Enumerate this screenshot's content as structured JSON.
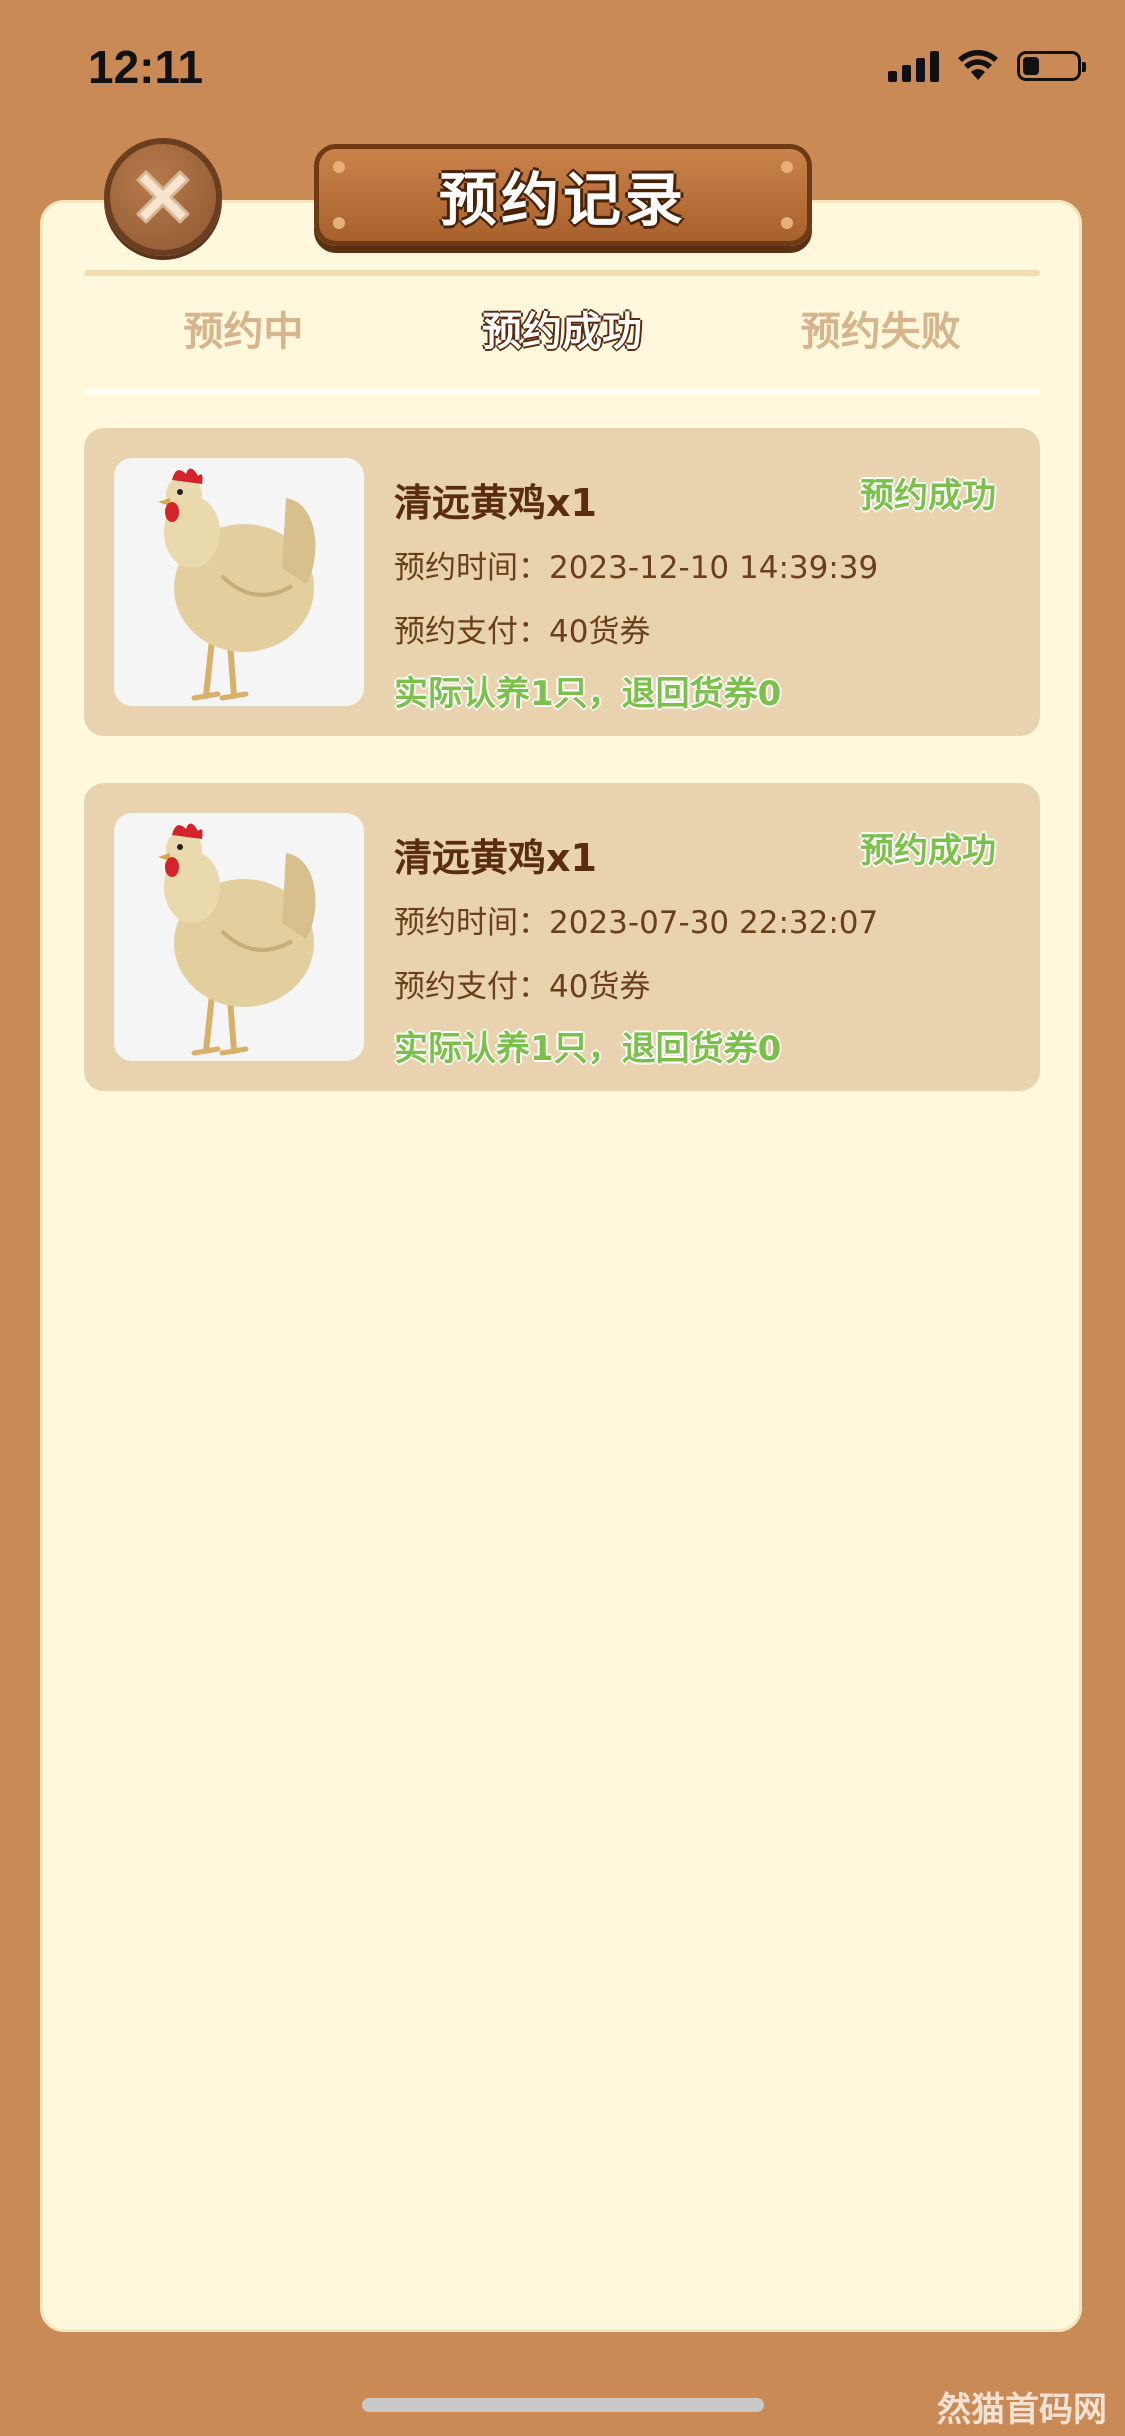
{
  "status_bar": {
    "time": "12:11",
    "battery_level": 0.25
  },
  "header": {
    "title": "预约记录",
    "close_icon": "close-x-icon"
  },
  "tabs": [
    {
      "label": "预约中",
      "active": false
    },
    {
      "label": "预约成功",
      "active": true
    },
    {
      "label": "预约失败",
      "active": false
    }
  ],
  "records": [
    {
      "name": "清远黄鸡x1",
      "status": "预约成功",
      "time_label": "预约时间：",
      "time": "2023-12-10 14:39:39",
      "pay_label": "预约支付：",
      "pay": "40货券",
      "result": "实际认养1只，退回货券0",
      "image_icon": "chicken-image"
    },
    {
      "name": "清远黄鸡x1",
      "status": "预约成功",
      "time_label": "预约时间：",
      "time": "2023-07-30 22:32:07",
      "pay_label": "预约支付：",
      "pay": "40货券",
      "result": "实际认养1只，退回货券0",
      "image_icon": "chicken-image"
    }
  ],
  "watermark": "然猫首码网",
  "colors": {
    "background": "#c98a55",
    "panel": "#fff8dc",
    "card": "#e8d3ae",
    "success": "#7ac04a",
    "brown": "#5a2d0f"
  }
}
